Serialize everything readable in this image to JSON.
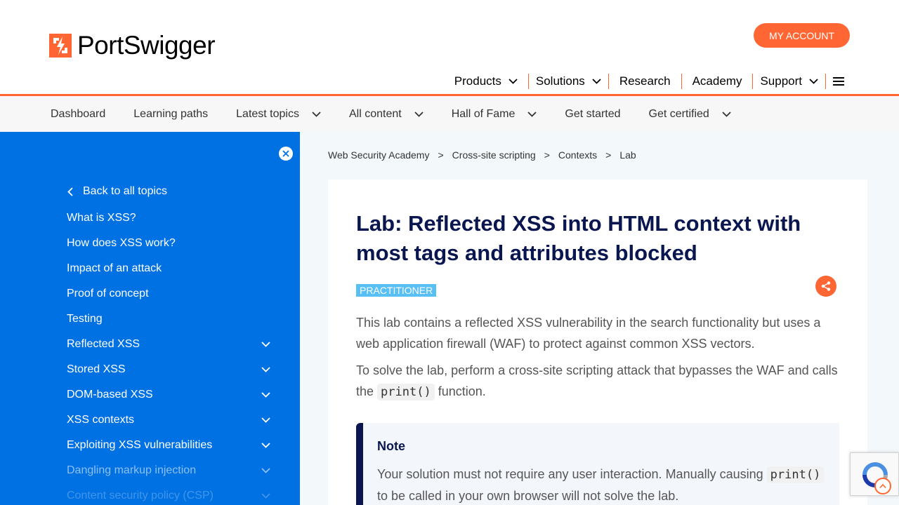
{
  "header": {
    "logo_text": "PortSwigger",
    "account_label": "MY ACCOUNT",
    "nav": [
      {
        "label": "Products",
        "dropdown": true
      },
      {
        "label": "Solutions",
        "dropdown": true
      },
      {
        "label": "Research",
        "dropdown": false
      },
      {
        "label": "Academy",
        "dropdown": false
      },
      {
        "label": "Support",
        "dropdown": true
      }
    ]
  },
  "subnav": [
    {
      "label": "Dashboard",
      "dropdown": false
    },
    {
      "label": "Learning paths",
      "dropdown": false
    },
    {
      "label": "Latest topics",
      "dropdown": true
    },
    {
      "label": "All content",
      "dropdown": true
    },
    {
      "label": "Hall of Fame",
      "dropdown": true
    },
    {
      "label": "Get started",
      "dropdown": false
    },
    {
      "label": "Get certified",
      "dropdown": true
    }
  ],
  "sidebar": {
    "back_label": "Back to all topics",
    "items": [
      {
        "label": "What is XSS?",
        "expandable": false
      },
      {
        "label": "How does XSS work?",
        "expandable": false
      },
      {
        "label": "Impact of an attack",
        "expandable": false
      },
      {
        "label": "Proof of concept",
        "expandable": false
      },
      {
        "label": "Testing",
        "expandable": false
      },
      {
        "label": "Reflected XSS",
        "expandable": true
      },
      {
        "label": "Stored XSS",
        "expandable": true
      },
      {
        "label": "DOM-based XSS",
        "expandable": true
      },
      {
        "label": "XSS contexts",
        "expandable": true
      },
      {
        "label": "Exploiting XSS vulnerabilities",
        "expandable": true
      },
      {
        "label": "Dangling markup injection",
        "expandable": true
      },
      {
        "label": "Content security policy (CSP)",
        "expandable": true
      }
    ]
  },
  "breadcrumb": [
    "Web Security Academy",
    "Cross-site scripting",
    "Contexts",
    "Lab"
  ],
  "content": {
    "title": "Lab: Reflected XSS into HTML context with most tags and attributes blocked",
    "badge": "PRACTITIONER",
    "para1": "This lab contains a reflected XSS vulnerability in the search functionality but uses a web application firewall (WAF) to protect against common XSS vectors.",
    "para2_before": "To solve the lab, perform a cross-site scripting attack that bypasses the WAF and calls the ",
    "para2_code": "print()",
    "para2_after": " function.",
    "note_title": "Note",
    "note_before": "Your solution must not require any user interaction. Manually causing ",
    "note_code": "print()",
    "note_after": " to be called in your own browser will not solve the lab."
  },
  "colors": {
    "brand": "#ff6633",
    "sidebar": "#0071e3",
    "title": "#0a1650",
    "badge": "#59c0f5"
  }
}
